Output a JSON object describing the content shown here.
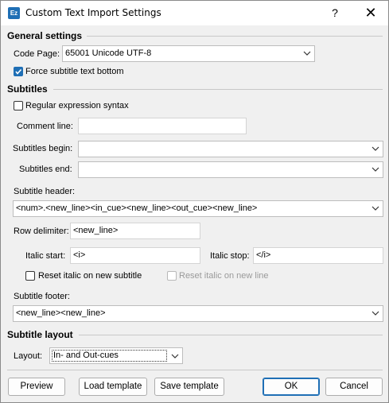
{
  "window": {
    "title": "Custom Text Import Settings",
    "app_icon": "Ez",
    "help": "?",
    "close": "✕"
  },
  "general": {
    "heading": "General settings",
    "code_page_label": "Code Page:",
    "code_page_value": "65001 Unicode UTF-8",
    "force_bottom_label": "Force subtitle text bottom",
    "force_bottom_checked": true
  },
  "subtitles": {
    "heading": "Subtitles",
    "regex_label": "Regular expression syntax",
    "regex_checked": false,
    "comment_label": "Comment line:",
    "comment_value": "",
    "begin_label": "Subtitles begin:",
    "begin_value": "",
    "end_label": "Subtitles end:",
    "end_value": "",
    "header_label": "Subtitle header:",
    "header_value": "<num>.<new_line><in_cue><new_line><out_cue><new_line>",
    "row_delim_label": "Row delimiter:",
    "row_delim_value": "<new_line>",
    "italic_start_label": "Italic start:",
    "italic_start_value": "<i>",
    "italic_stop_label": "Italic stop:",
    "italic_stop_value": "</i>",
    "reset_italic_sub_label": "Reset italic on new subtitle",
    "reset_italic_line_label": "Reset italic on new line",
    "footer_label": "Subtitle footer:",
    "footer_value": "<new_line><new_line>"
  },
  "layout": {
    "heading": "Subtitle layout",
    "layout_label": "Layout:",
    "layout_value": "In- and Out-cues"
  },
  "buttons": {
    "preview": "Preview",
    "load": "Load template",
    "save": "Save template",
    "ok": "OK",
    "cancel": "Cancel"
  },
  "colors": {
    "accent": "#1f6fb5"
  }
}
